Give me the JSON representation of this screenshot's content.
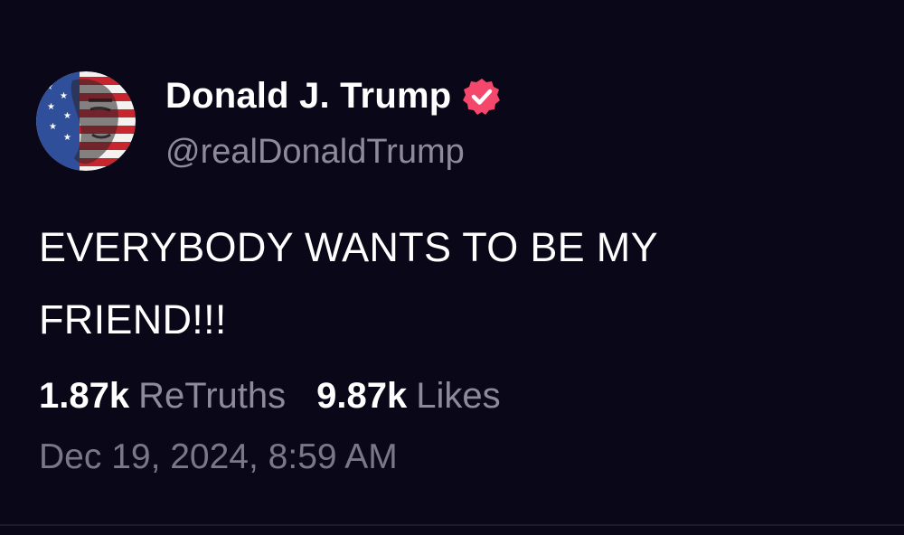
{
  "post": {
    "author": {
      "display_name": "Donald J. Trump",
      "handle": "@realDonaldTrump",
      "verified": true,
      "verified_icon": "verified-badge-icon",
      "avatar_icon": "flag-portrait-avatar"
    },
    "text": "EVERYBODY WANTS TO BE MY FRIEND!!!",
    "stats": {
      "retruths_count": "1.87k",
      "retruths_label": "ReTruths",
      "likes_count": "9.87k",
      "likes_label": "Likes"
    },
    "timestamp": "Dec 19, 2024, 8:59 AM"
  },
  "colors": {
    "background": "#0a0818",
    "text_primary": "#ffffff",
    "text_secondary": "#8e8a9c",
    "verified_badge": "#f4476b"
  }
}
